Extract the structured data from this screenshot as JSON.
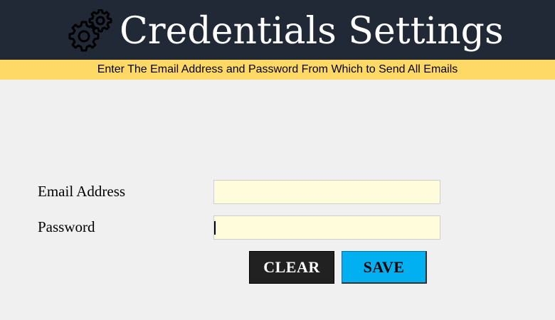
{
  "header": {
    "title": "Credentials Settings",
    "icon": "gear-icon",
    "background": "#222936"
  },
  "subtitle_bar": {
    "text": "Enter The Email Address and Password From Which to Send All Emails",
    "background": "#ffd966"
  },
  "form": {
    "email": {
      "label": "Email Address",
      "value": "",
      "placeholder": ""
    },
    "password": {
      "label": "Password",
      "value": "",
      "placeholder": ""
    },
    "input_background": "#fffcdc"
  },
  "buttons": {
    "clear_label": "CLEAR",
    "clear_color": "#212121",
    "save_label": "SAVE",
    "save_color": "#00b0f0"
  }
}
